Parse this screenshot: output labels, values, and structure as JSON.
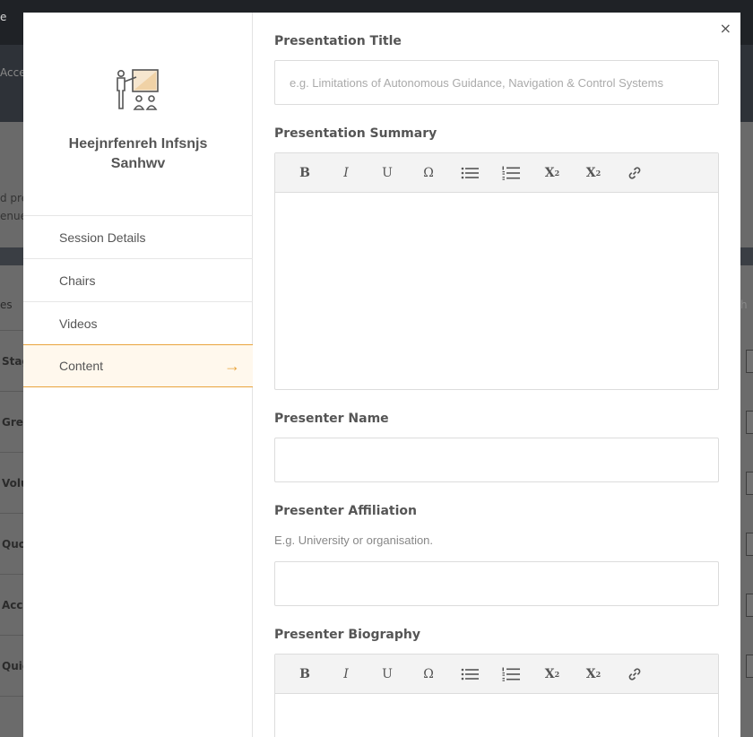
{
  "modal": {
    "event_title": "Heejnrfenreh Infsnjs Sanhwv",
    "close_label": "×",
    "nav": [
      {
        "label": "Session Details"
      },
      {
        "label": "Chairs"
      },
      {
        "label": "Videos"
      },
      {
        "label": "Content"
      }
    ],
    "active_arrow": "→"
  },
  "form": {
    "title": {
      "label": "Presentation Title",
      "placeholder": "e.g. Limitations of Autonomous Guidance, Navigation & Control Systems"
    },
    "summary": {
      "label": "Presentation Summary"
    },
    "presenter_name": {
      "label": "Presenter Name",
      "placeholder": ""
    },
    "affiliation": {
      "label": "Presenter Affiliation",
      "hint": "E.g. University or organisation.",
      "placeholder": ""
    },
    "biography": {
      "label": "Presenter Biography"
    }
  },
  "toolbar": {
    "bold": "B",
    "italic": "I",
    "underline": "U",
    "omega": "Ω",
    "superscript": "X",
    "sup_mark": "2",
    "subscript": "X",
    "sub_mark": "2"
  },
  "background": {
    "top_left": "e",
    "acce": "Acces",
    "d_pre": "d pre",
    "venue": "enue",
    "es": "es",
    "rows": [
      "Stag",
      "Gree",
      "Volu",
      "Quo",
      "Acc",
      "Quid"
    ],
    "right_search": "h"
  },
  "colors": {
    "accent": "#e9a43d",
    "active_bg": "#fff8ed"
  }
}
